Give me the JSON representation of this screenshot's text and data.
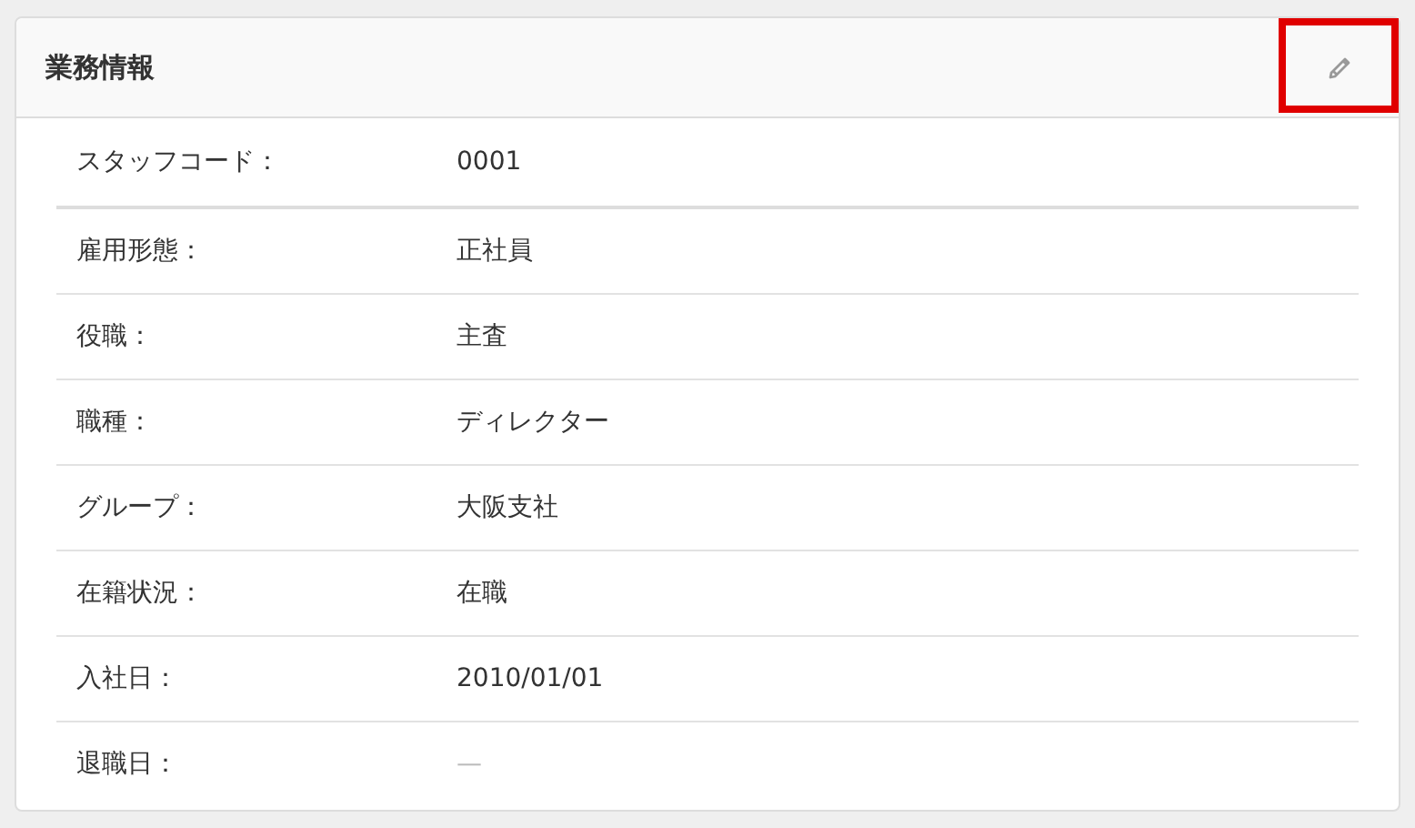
{
  "panel": {
    "title": "業務情報",
    "edit_highlighted": true
  },
  "rows": [
    {
      "label": "スタッフコード：",
      "value": "0001",
      "empty": false
    },
    {
      "label": "雇用形態：",
      "value": "正社員",
      "empty": false
    },
    {
      "label": "役職：",
      "value": "主査",
      "empty": false
    },
    {
      "label": "職種：",
      "value": "ディレクター",
      "empty": false
    },
    {
      "label": "グループ：",
      "value": "大阪支社",
      "empty": false
    },
    {
      "label": "在籍状況：",
      "value": "在職",
      "empty": false
    },
    {
      "label": "入社日：",
      "value": "2010/01/01",
      "empty": false
    },
    {
      "label": "退職日：",
      "value": "—",
      "empty": true
    }
  ]
}
